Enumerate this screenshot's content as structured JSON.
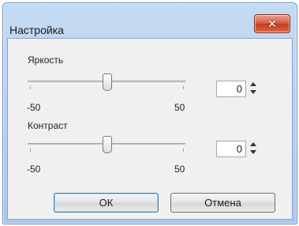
{
  "window": {
    "title": "Настройка",
    "close_glyph": "✕"
  },
  "brightness": {
    "label": "Яркость",
    "min_label": "-50",
    "max_label": "50",
    "value": "0",
    "slider_level": 0
  },
  "contrast": {
    "label": "Контраст",
    "min_label": "-50",
    "max_label": "50",
    "value": "0",
    "slider_level": 0
  },
  "buttons": {
    "ok": "ОК",
    "cancel": "Отмена"
  },
  "icons": {
    "close": "close-icon",
    "spin_up": "spin-up-icon",
    "spin_down": "spin-down-icon"
  },
  "colors": {
    "close_button": "#c94a2c",
    "titlebar": "#b8d2ef",
    "dialog_bg": "#f0f0f0"
  }
}
